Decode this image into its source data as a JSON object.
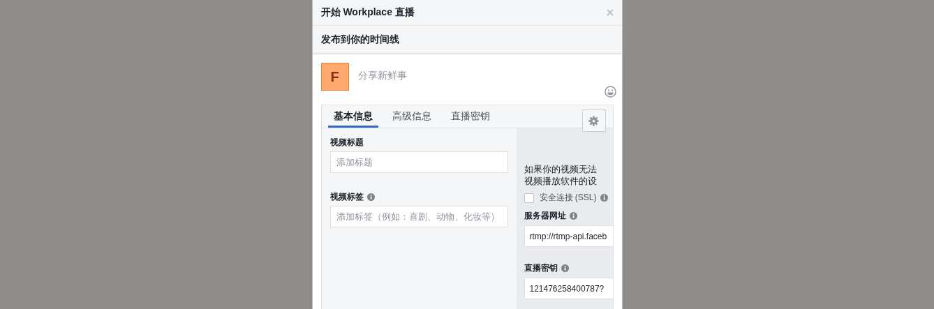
{
  "dialog": {
    "title": "开始 Workplace 直播"
  },
  "section": {
    "title": "发布到你的时间线"
  },
  "composer": {
    "avatar_letter": "F",
    "placeholder": "分享新鲜事"
  },
  "tabs": [
    {
      "label": "基本信息",
      "selected": true
    },
    {
      "label": "高级信息",
      "selected": false
    },
    {
      "label": "直播密钥",
      "selected": false
    }
  ],
  "basic_fields": [
    {
      "label": "视频标题",
      "placeholder": "添加标题",
      "info": false
    },
    {
      "label": "视频标签",
      "placeholder": "添加标签（例如：喜剧、动物、化妆等）",
      "info": true
    }
  ],
  "stream_panel": {
    "notice_lines": [
      "如果你的视频无法",
      "视频播放软件的设"
    ],
    "ssl": {
      "label": "安全连接 (SSL)",
      "checked": false
    },
    "fields": [
      {
        "label": "服务器网址",
        "value": "rtmp://rtmp-api.faceb"
      },
      {
        "label": "直播密钥",
        "value": "121476258400787?"
      }
    ]
  }
}
